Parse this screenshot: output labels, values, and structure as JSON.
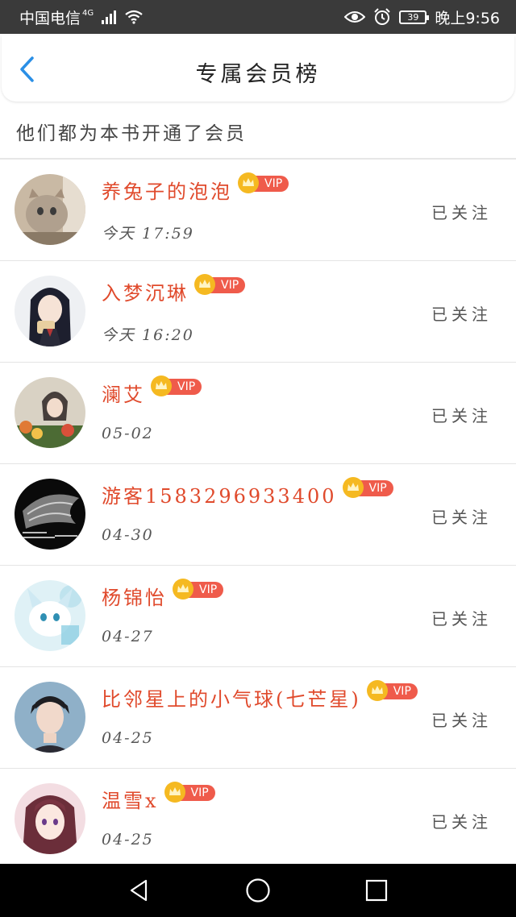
{
  "status_bar": {
    "carrier": "中国电信",
    "network": "4G",
    "battery": "39",
    "time": "晚上9:56"
  },
  "header": {
    "title": "专属会员榜"
  },
  "subtitle": "他们都为本书开通了会员",
  "vip_label": "VIP",
  "members": [
    {
      "name": "养兔子的泡泡",
      "date": "今天 17:59",
      "follow": "已关注"
    },
    {
      "name": "入梦沉琳",
      "date": "今天 16:20",
      "follow": "已关注"
    },
    {
      "name": "澜艾",
      "date": "05-02",
      "follow": "已关注"
    },
    {
      "name": "游客1583296933400",
      "date": "04-30",
      "follow": "已关注"
    },
    {
      "name": "杨锦怡",
      "date": "04-27",
      "follow": "已关注"
    },
    {
      "name": "比邻星上的小气球(七芒星)",
      "date": "04-25",
      "follow": "已关注"
    },
    {
      "name": "温雪x",
      "date": "04-25",
      "follow": "已关注"
    }
  ],
  "colors": {
    "accent_blue": "#2a8fe6",
    "name_red": "#e04a2c",
    "vip_red": "#ef5b4b",
    "crown_gold": "#f5b921"
  }
}
